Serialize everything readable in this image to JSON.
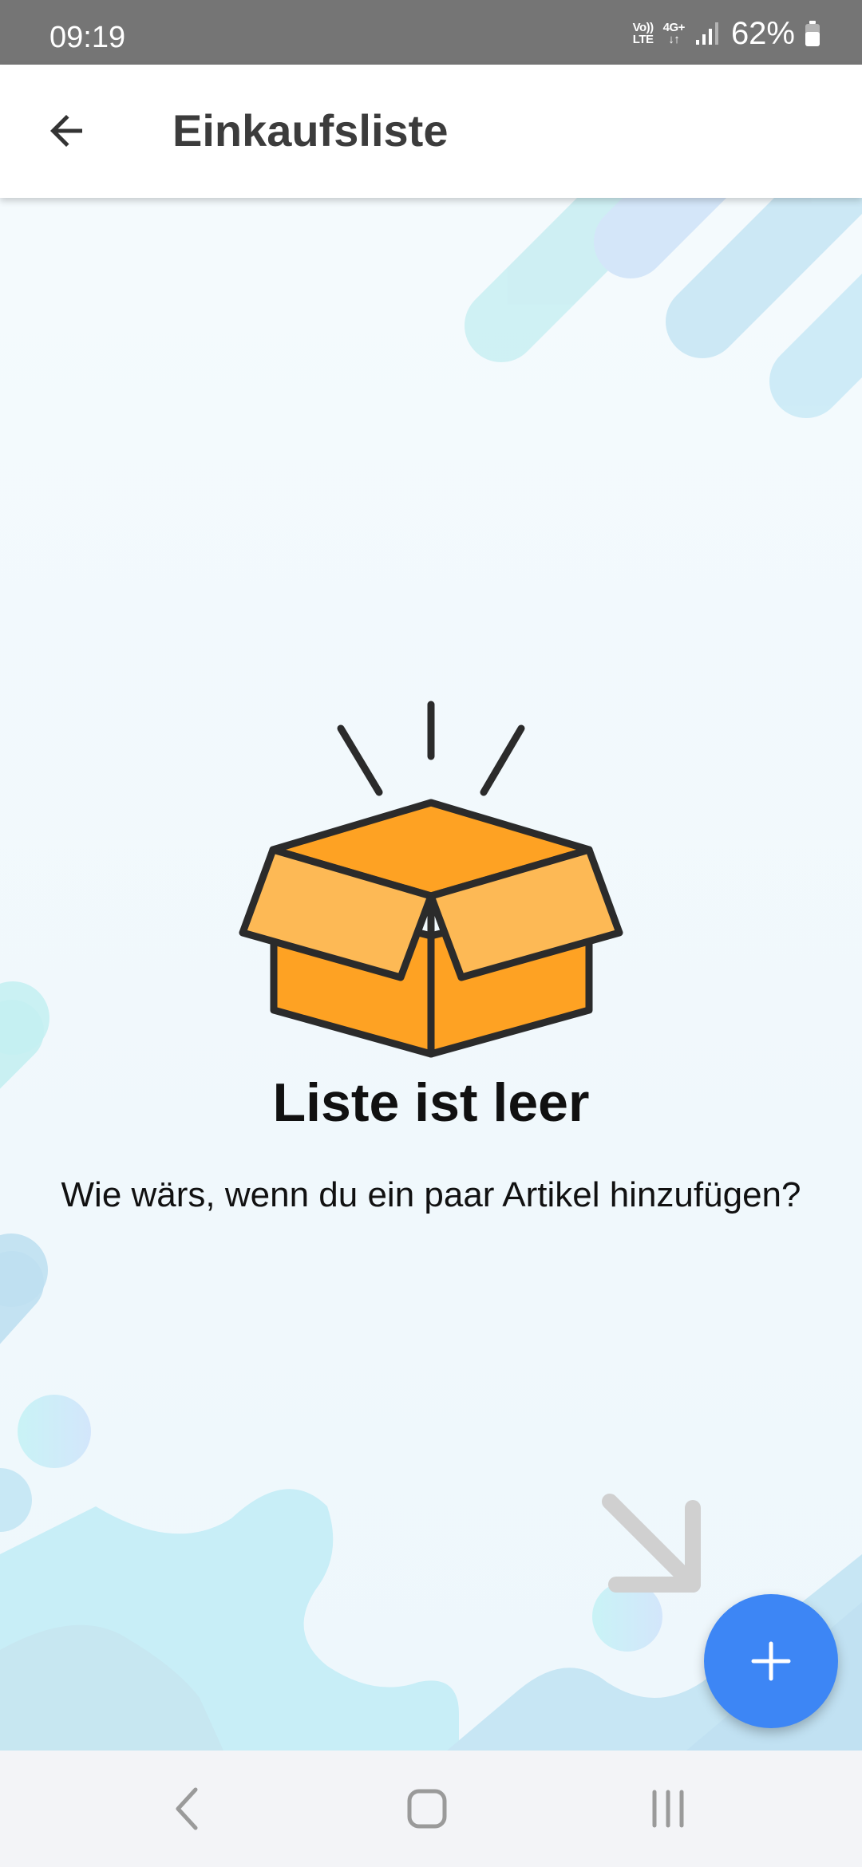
{
  "status_bar": {
    "time": "09:19",
    "volte_line1": "Vo))",
    "volte_line2": "LTE",
    "network_line1": "4G+",
    "network_line2": "↓↑",
    "battery": "62%",
    "signal_icon": "cell-signal-icon",
    "battery_icon": "battery-icon"
  },
  "app_bar": {
    "title": "Einkaufsliste",
    "back_icon": "arrow-left-icon"
  },
  "empty_state": {
    "illustration": "open-box-icon",
    "title": "Liste ist leer",
    "subtitle": "Wie wärs, wenn du ein paar Artikel hinzufügen?",
    "hint_icon": "arrow-down-right-icon"
  },
  "fab": {
    "icon": "plus-icon"
  },
  "nav_bar": {
    "back": "nav-back-icon",
    "home": "nav-home-icon",
    "recents": "nav-recents-icon"
  },
  "colors": {
    "status_bar": "#757575",
    "app_bar": "#ffffff",
    "fab": "#3d86f5",
    "box_top": "#fdb955",
    "box_front": "#fea223",
    "outline": "#2b2b2b"
  }
}
